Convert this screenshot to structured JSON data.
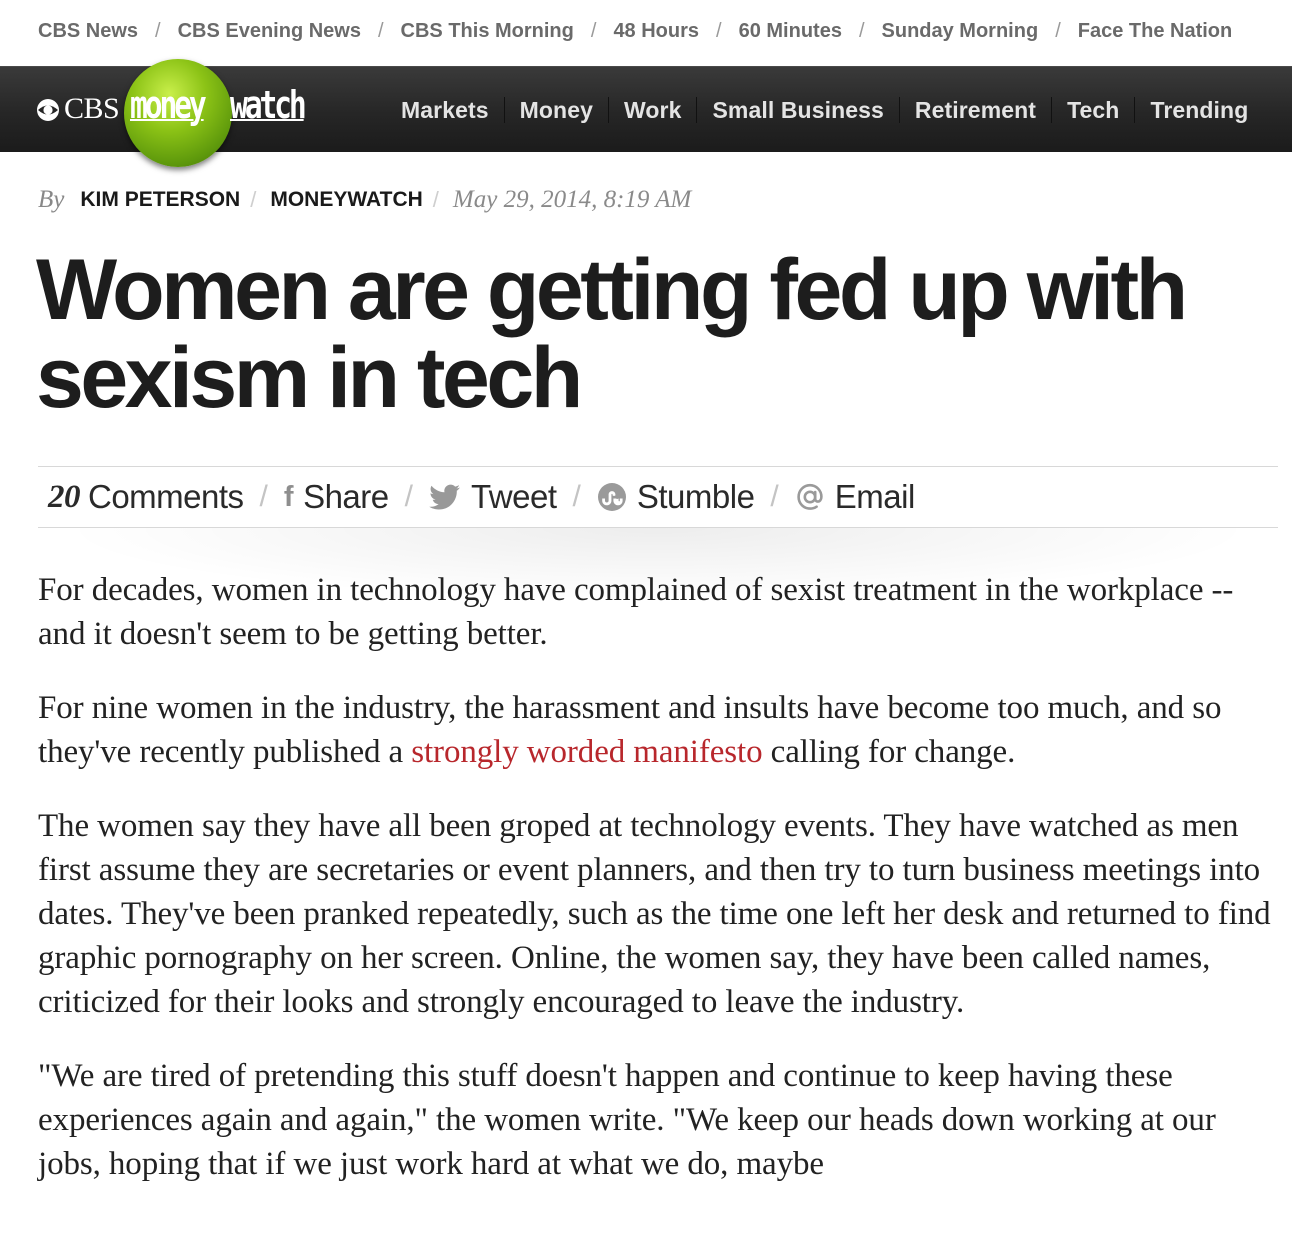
{
  "network_nav": {
    "items": [
      "CBS News",
      "CBS Evening News",
      "CBS This Morning",
      "48 Hours",
      "60 Minutes",
      "Sunday Morning",
      "Face The Nation"
    ],
    "separator": "/"
  },
  "brand": {
    "cbs": "CBS",
    "money": "money",
    "watch": "watch",
    "accent_color": "#8cc316"
  },
  "main_nav": {
    "items": [
      "Markets",
      "Money",
      "Work",
      "Small Business",
      "Retirement",
      "Tech",
      "Trending"
    ]
  },
  "byline": {
    "by": "By",
    "author": "KIM PETERSON",
    "outlet": "MONEYWATCH",
    "separator": "/",
    "date": "May 29, 2014, 8:19 AM"
  },
  "headline": "Women are getting fed up with sexism in tech",
  "share_bar": {
    "comment_count": "20",
    "comments_label": "Comments",
    "share_label": "Share",
    "tweet_label": "Tweet",
    "stumble_label": "Stumble",
    "email_label": "Email",
    "separator": "/"
  },
  "article": {
    "p1": "For decades, women in technology have complained of sexist treatment in the workplace -- and it doesn't seem to be getting better.",
    "p2_before": "For nine women in the industry, the harassment and insults have become too much, and so they've recently published a ",
    "p2_link": "strongly worded manifesto",
    "p2_after": " calling for change.",
    "p3": "The women say they have all been groped at technology events. They have watched as men first assume they are secretaries or event planners, and then try to turn business meetings into dates. They've been pranked repeatedly, such as the time one left her desk and returned to find graphic pornography on her screen. Online, the women say, they have been called names, criticized for their looks and strongly encouraged to leave the industry.",
    "p4": "\"We are tired of pretending this stuff doesn't happen and continue to keep having these experiences again and again,\" the women write. \"We keep our heads down working at our jobs, hoping that if we just work hard at what we do, maybe",
    "link_color": "#b8272c"
  }
}
